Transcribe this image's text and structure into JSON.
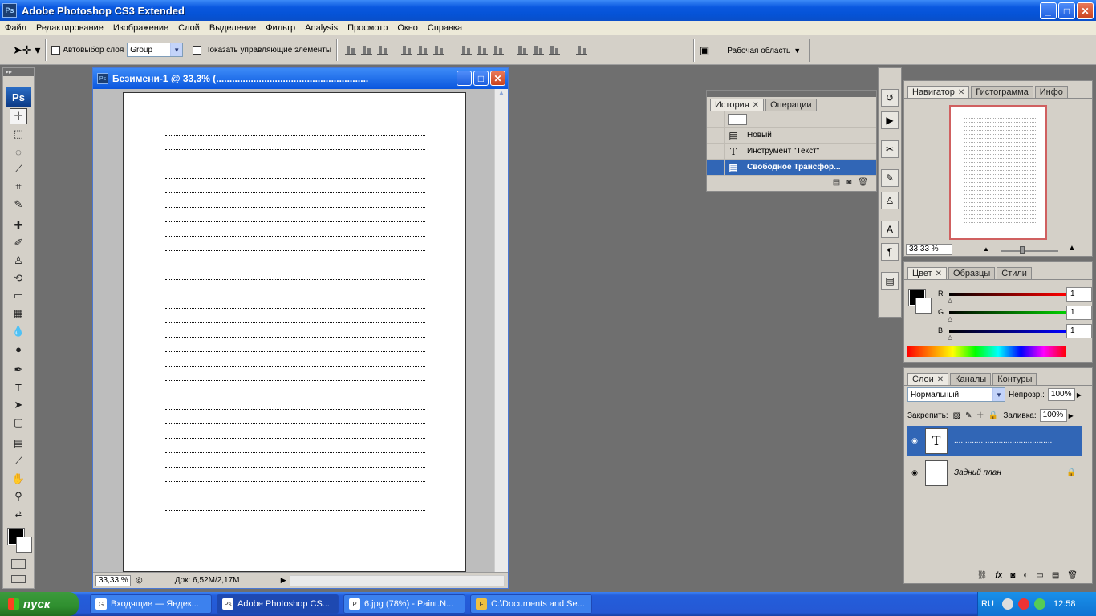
{
  "window": {
    "title": "Adobe Photoshop CS3 Extended",
    "icon": "Ps",
    "min": "_",
    "max": "□",
    "close": "✕"
  },
  "menu": [
    "Файл",
    "Редактирование",
    "Изображение",
    "Слой",
    "Выделение",
    "Фильтр",
    "Analysis",
    "Просмотр",
    "Окно",
    "Справка"
  ],
  "options": {
    "auto_select_label": "Автовыбор слоя",
    "group_value": "Group",
    "show_controls_label": "Показать управляющие элементы",
    "workspace_label": "Рабочая область"
  },
  "toolbox": {
    "logo": "Ps",
    "head": "▸▸"
  },
  "document": {
    "title": "Безимени-1 @ 33,3% (.........................................................",
    "icon": "Ps",
    "zoom": "33,33 %",
    "docinfo": "Док: 6,52M/2,17M"
  },
  "history": {
    "tabs": [
      "История",
      "Операции"
    ],
    "rows": [
      {
        "icon": "▤",
        "label": "Новый"
      },
      {
        "icon": "T",
        "label": "Инструмент \"Текст\""
      },
      {
        "icon": "▤",
        "label": "Свободное Трансфор..."
      }
    ]
  },
  "navigator": {
    "tabs": [
      "Навигатор",
      "Гистограмма",
      "Инфо"
    ],
    "zoom": "33.33 %"
  },
  "color": {
    "tabs": [
      "Цвет",
      "Образцы",
      "Стили"
    ],
    "channels": [
      {
        "label": "R",
        "value": "1",
        "color": "#ff0000"
      },
      {
        "label": "G",
        "value": "1",
        "color": "#00c000"
      },
      {
        "label": "B",
        "value": "1",
        "color": "#0000ff"
      }
    ]
  },
  "layers": {
    "tabs": [
      "Слои",
      "Каналы",
      "Контуры"
    ],
    "blend_mode": "Нормальный",
    "opacity_label": "Непрозр.:",
    "opacity": "100%",
    "lock_label": "Закрепить:",
    "fill_label": "Заливка:",
    "fill": "100%",
    "items": [
      {
        "thumb": "T",
        "name": "............................................"
      },
      {
        "thumb": "",
        "name": "Задний план"
      }
    ]
  },
  "taskbar": {
    "start": "пуск",
    "tasks": [
      {
        "icon": "G",
        "label": "Входящие — Яндек..."
      },
      {
        "icon": "Ps",
        "label": "Adobe Photoshop CS..."
      },
      {
        "icon": "P",
        "label": "6.jpg (78%) - Paint.N..."
      },
      {
        "icon": "F",
        "label": "C:\\Documents and Se..."
      }
    ],
    "lang": "RU",
    "clock": "12:58"
  }
}
